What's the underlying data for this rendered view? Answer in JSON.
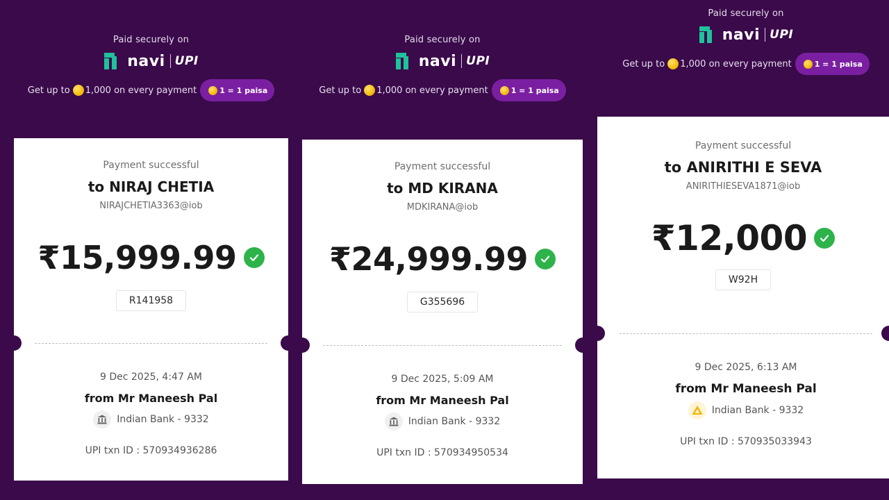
{
  "receipts": [
    {
      "paid_on": "Paid securely on",
      "brand": "navi",
      "upi": "UPI",
      "promo_prefix": "Get up to",
      "promo_amount": "1,000 on every payment",
      "paisa_label": "1 = 1 paisa",
      "status": "Payment successful",
      "payee": "to NIRAJ CHETIA",
      "vpa": "NIRAJCHETIA3363@iob",
      "amount": "₹15,999.99",
      "ref": "R141958",
      "datetime": "9 Dec 2025, 4:47 AM",
      "from": "from Mr Maneesh Pal",
      "bank": "Indian Bank - 9332",
      "bank_icon": "bank-building-icon",
      "txn": "UPI txn ID : 570934936286"
    },
    {
      "paid_on": "Paid securely on",
      "brand": "navi",
      "upi": "UPI",
      "promo_prefix": "Get up to",
      "promo_amount": "1,000 on every payment",
      "paisa_label": "1 = 1 paisa",
      "status": "Payment successful",
      "payee": "to MD KIRANA",
      "vpa": "MDKIRANA@iob",
      "amount": "₹24,999.99",
      "ref": "G355696",
      "datetime": "9 Dec 2025, 5:09 AM",
      "from": "from Mr Maneesh Pal",
      "bank": "Indian Bank - 9332",
      "bank_icon": "bank-building-icon",
      "txn": "UPI txn ID : 570934950534"
    },
    {
      "paid_on": "Paid securely on",
      "brand": "navi",
      "upi": "UPI",
      "promo_prefix": "Get up to",
      "promo_amount": "1,000 on every payment",
      "paisa_label": "1 = 1 paisa",
      "status": "Payment successful",
      "payee": "to ANIRITHI E SEVA",
      "vpa": "ANIRITHIESEVA1871@iob",
      "amount": "₹12,000",
      "ref": "W92H",
      "datetime": "9 Dec 2025, 6:13 AM",
      "from": "from Mr Maneesh Pal",
      "bank": "Indian Bank - 9332",
      "bank_icon": "indian-bank-logo-icon",
      "txn": "UPI txn ID : 570935033943"
    }
  ],
  "colors": {
    "background": "#3a0a4a",
    "accent_pill": "#7b1fa2",
    "success": "#2db34a",
    "navi_green": "#1fc29b"
  }
}
